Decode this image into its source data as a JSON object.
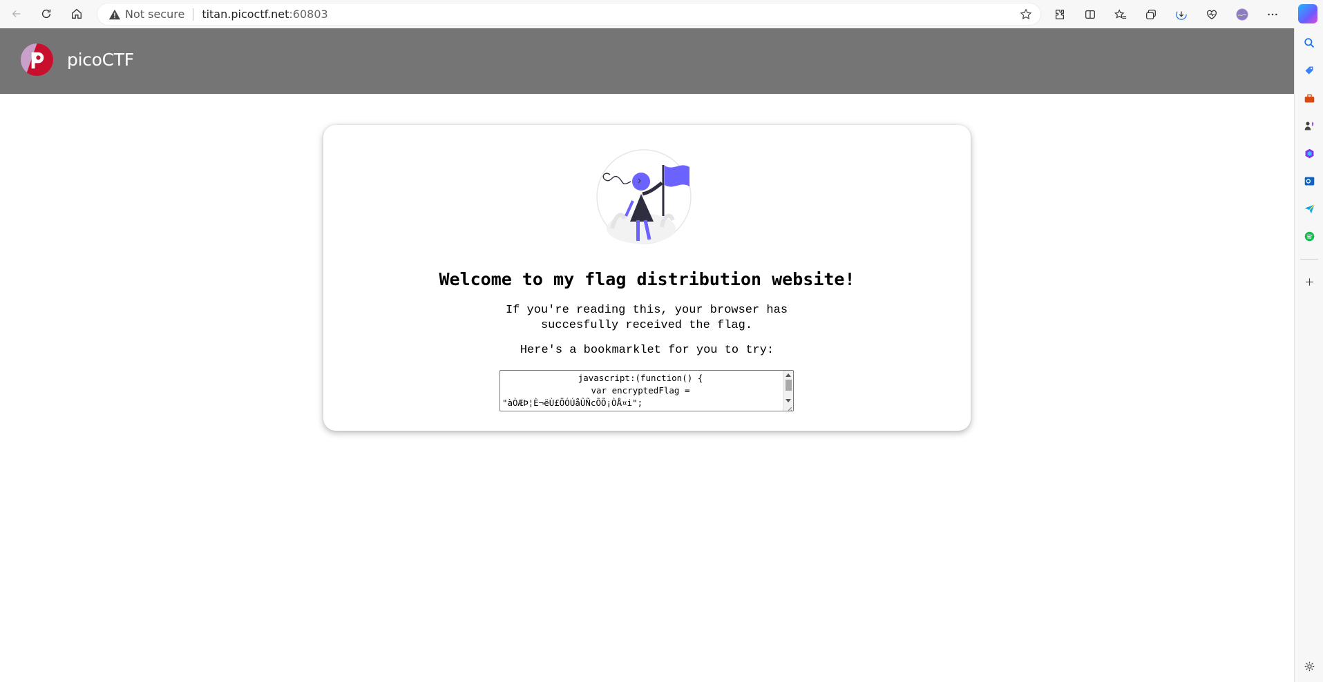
{
  "browser": {
    "security_label": "Not secure",
    "url_host": "titan.picoctf.net",
    "url_port": ":60803",
    "toolbar_icons": [
      "back-icon",
      "refresh-icon",
      "home-icon",
      "extensions-icon",
      "split-screen-icon",
      "favorites-icon",
      "collections-icon",
      "downloads-icon",
      "browser-essentials-icon",
      "profile-avatar",
      "more-icon"
    ],
    "sidebar_icons": [
      "search-icon",
      "shopping-tag-icon",
      "tools-icon",
      "games-icon",
      "microsoft-365-icon",
      "outlook-icon",
      "send-icon",
      "spotify-icon",
      "add-icon",
      "settings-icon"
    ]
  },
  "site": {
    "brand": "picoCTF",
    "brand_color": "#c8102e",
    "header_color": "#757575"
  },
  "content": {
    "heading": "Welcome to my flag distribution website!",
    "message": "If you're reading this, your browser has succesfully received the flag.",
    "bookmarklet_intro": "Here's a bookmarklet for you to try:",
    "code_line1": "javascript:(function() {",
    "code_line2": "var encryptedFlag =",
    "code_line3": "\"àÒÆÞ¦È¬ëÙ£ÖÓÚåÛÑcÕÕ¡ÒÅ¤i\";",
    "illustration_accent": "#6c63ff"
  }
}
